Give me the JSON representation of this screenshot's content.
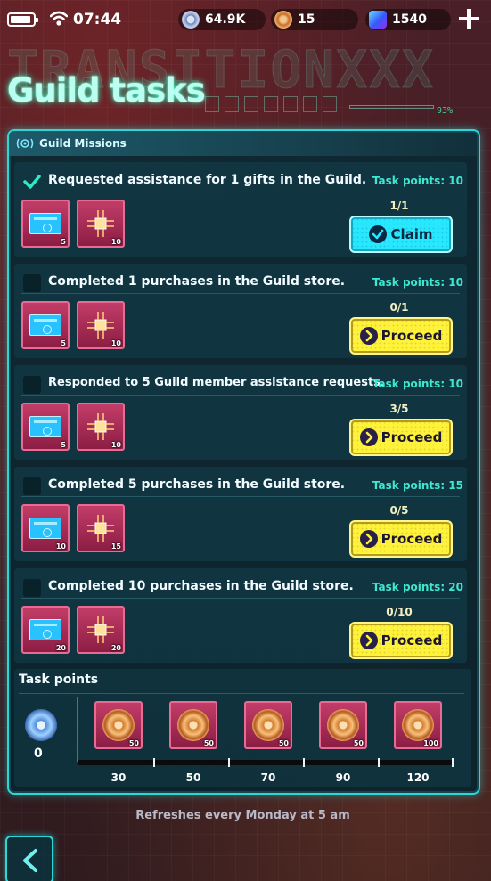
{
  "status_bar": {
    "time": "07:44",
    "currencies": [
      {
        "icon": "gear-coin-icon",
        "value": "64.9K"
      },
      {
        "icon": "bronze-coin-icon",
        "value": "15"
      },
      {
        "icon": "gem-icon",
        "value": "1540"
      }
    ]
  },
  "header": {
    "background_text": "TRANSITIONXXX",
    "title": "Guild tasks",
    "deco_percent": "93%"
  },
  "panel": {
    "title": "Guild Missions"
  },
  "tasks": [
    {
      "description": "Requested assistance for 1 gifts in the Guild.",
      "points_label": "Task points: 10",
      "completed": true,
      "rewards": [
        {
          "icon": "ticket-icon",
          "qty": "5"
        },
        {
          "icon": "chip-icon",
          "qty": "10"
        }
      ],
      "progress": "1/1",
      "action": "Claim"
    },
    {
      "description": "Completed 1 purchases in the Guild store.",
      "points_label": "Task points: 10",
      "completed": false,
      "rewards": [
        {
          "icon": "ticket-icon",
          "qty": "5"
        },
        {
          "icon": "chip-icon",
          "qty": "10"
        }
      ],
      "progress": "0/1",
      "action": "Proceed"
    },
    {
      "description": "Responded to 5 Guild member assistance requests.",
      "points_label": "Task points: 10",
      "completed": false,
      "rewards": [
        {
          "icon": "ticket-icon",
          "qty": "5"
        },
        {
          "icon": "chip-icon",
          "qty": "10"
        }
      ],
      "progress": "3/5",
      "action": "Proceed"
    },
    {
      "description": "Completed 5 purchases in the Guild store.",
      "points_label": "Task points: 15",
      "completed": false,
      "rewards": [
        {
          "icon": "ticket-icon",
          "qty": "10"
        },
        {
          "icon": "chip-icon",
          "qty": "15"
        }
      ],
      "progress": "0/5",
      "action": "Proceed"
    },
    {
      "description": "Completed 10 purchases in the Guild store.",
      "points_label": "Task points: 20",
      "completed": false,
      "rewards": [
        {
          "icon": "ticket-icon",
          "qty": "20"
        },
        {
          "icon": "chip-icon",
          "qty": "20"
        }
      ],
      "progress": "0/10",
      "action": "Proceed"
    }
  ],
  "task_points": {
    "title": "Task points",
    "current": "0",
    "milestones": [
      {
        "points": "30",
        "reward_qty": "50"
      },
      {
        "points": "50",
        "reward_qty": "50"
      },
      {
        "points": "70",
        "reward_qty": "50"
      },
      {
        "points": "90",
        "reward_qty": "50"
      },
      {
        "points": "120",
        "reward_qty": "100"
      }
    ]
  },
  "footer": {
    "refresh_text": "Refreshes every Monday at 5 am"
  }
}
